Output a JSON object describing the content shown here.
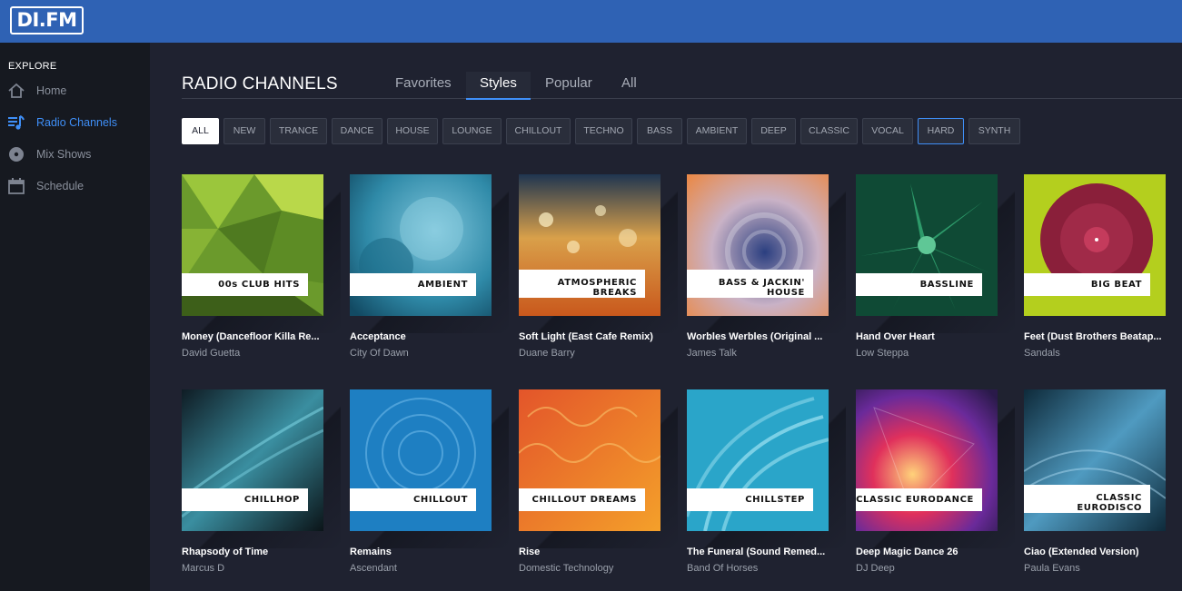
{
  "app": {
    "logo_text": "DI.FM"
  },
  "sidebar": {
    "section_label": "EXPLORE",
    "items": [
      {
        "label": "Home",
        "icon": "home-icon",
        "active": false
      },
      {
        "label": "Radio Channels",
        "icon": "radio-channels-icon",
        "active": true
      },
      {
        "label": "Mix Shows",
        "icon": "vinyl-icon",
        "active": false
      },
      {
        "label": "Schedule",
        "icon": "calendar-icon",
        "active": false
      }
    ]
  },
  "main": {
    "title": "RADIO CHANNELS",
    "tabs": [
      {
        "label": "Favorites",
        "active": false
      },
      {
        "label": "Styles",
        "active": true
      },
      {
        "label": "Popular",
        "active": false
      },
      {
        "label": "All",
        "active": false
      }
    ],
    "filters": [
      "ALL",
      "NEW",
      "TRANCE",
      "DANCE",
      "HOUSE",
      "LOUNGE",
      "CHILLOUT",
      "TECHNO",
      "BASS",
      "AMBIENT",
      "DEEP",
      "CLASSIC",
      "VOCAL",
      "HARD",
      "SYNTH"
    ],
    "active_filter": "ALL",
    "highlighted_filter": "HARD"
  },
  "channels": [
    {
      "name": "00s CLUB HITS",
      "name_line2": "",
      "track": "Money (Dancefloor Killa Re...",
      "artist": "David Guetta"
    },
    {
      "name": "AMBIENT",
      "name_line2": "",
      "track": "Acceptance",
      "artist": "City Of Dawn"
    },
    {
      "name": "ATMOSPHERIC",
      "name_line2": "BREAKS",
      "track": "Soft Light (East Cafe Remix)",
      "artist": "Duane Barry"
    },
    {
      "name": "BASS & JACKIN'",
      "name_line2": "HOUSE",
      "track": "Worbles Werbles (Original ...",
      "artist": "James Talk"
    },
    {
      "name": "BASSLINE",
      "name_line2": "",
      "track": "Hand Over Heart",
      "artist": "Low Steppa"
    },
    {
      "name": "BIG BEAT",
      "name_line2": "",
      "track": "Feet (Dust Brothers Beatap...",
      "artist": "Sandals"
    },
    {
      "name": "CHILLHOP",
      "name_line2": "",
      "track": "Rhapsody of Time",
      "artist": "Marcus D"
    },
    {
      "name": "CHILLOUT",
      "name_line2": "",
      "track": "Remains",
      "artist": "Ascendant"
    },
    {
      "name": "CHILLOUT DREAMS",
      "name_line2": "",
      "track": "Rise",
      "artist": "Domestic Technology"
    },
    {
      "name": "CHILLSTEP",
      "name_line2": "",
      "track": "The Funeral (Sound Remed...",
      "artist": "Band Of Horses"
    },
    {
      "name": "CLASSIC EURODANCE",
      "name_line2": "",
      "track": "Deep Magic Dance 26",
      "artist": "DJ Deep"
    },
    {
      "name": "CLASSIC",
      "name_line2": "EURODISCO",
      "track": "Ciao (Extended Version)",
      "artist": "Paula Evans"
    }
  ],
  "colors": {
    "topbar": "#2f62b4",
    "accent": "#3f8ff7",
    "background": "#1f2230",
    "sidebar": "#161920"
  }
}
